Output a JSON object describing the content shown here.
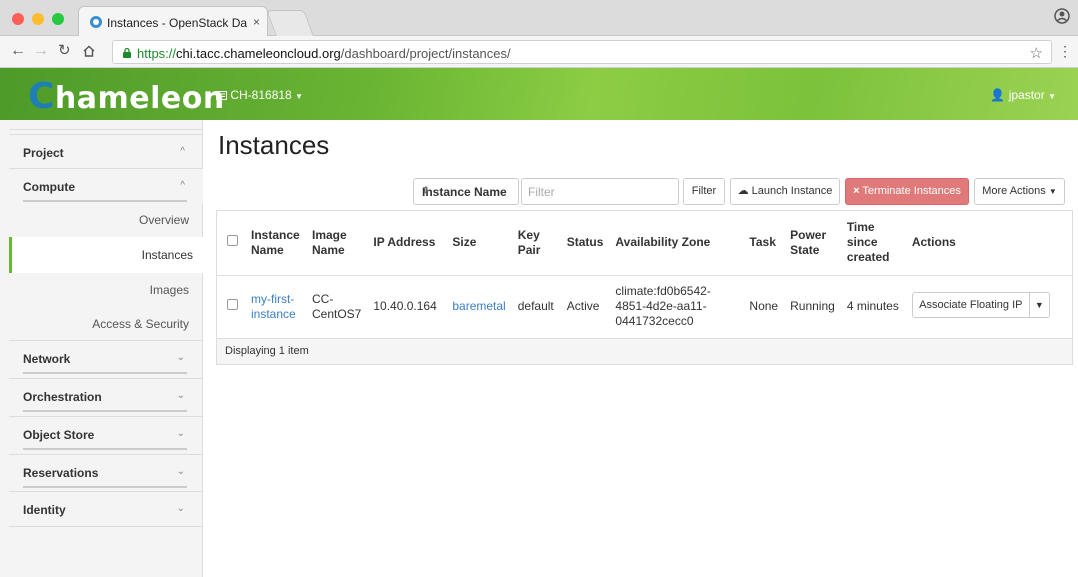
{
  "browser": {
    "tab_title": "Instances - OpenStack Dashbo",
    "tab_close": "×",
    "url_scheme": "https://",
    "url_host": "chi.tacc.chameleoncloud.org",
    "url_path": "/dashboard/project/instances/"
  },
  "header": {
    "logo_first": "C",
    "logo_rest": "hameleon",
    "project": "CH-816818",
    "user": "jpastor"
  },
  "sidebar": {
    "project": "Project",
    "compute": "Compute",
    "overview": "Overview",
    "instances": "Instances",
    "images": "Images",
    "access_security": "Access & Security",
    "network": "Network",
    "orchestration": "Orchestration",
    "object_store": "Object Store",
    "reservations": "Reservations",
    "identity": "Identity"
  },
  "main": {
    "title": "Instances",
    "filter_field": "Instance Name",
    "filter_placeholder": "Filter",
    "filter_button": "Filter",
    "launch_button": "Launch Instance",
    "terminate_button": "Terminate Instances",
    "more_actions": "More Actions"
  },
  "table": {
    "headers": {
      "name": [
        "Instance",
        "Name"
      ],
      "image": [
        "Image",
        "Name"
      ],
      "ip": "IP Address",
      "size": "Size",
      "keypair": [
        "Key",
        "Pair"
      ],
      "status": "Status",
      "zone": "Availability Zone",
      "task": "Task",
      "power": [
        "Power",
        "State"
      ],
      "time": [
        "Time",
        "since",
        "created"
      ],
      "actions": "Actions"
    },
    "row": {
      "name": [
        "my-first-",
        "instance"
      ],
      "image": [
        "CC-",
        "CentOS7"
      ],
      "ip": "10.40.0.164",
      "size": "baremetal",
      "keypair": "default",
      "status": "Active",
      "zone": [
        "climate:fd0b6542-",
        "4851-4d2e-aa11-",
        "0441732cecc0"
      ],
      "task": "None",
      "power": "Running",
      "time": "4 minutes",
      "action": "Associate Floating IP"
    },
    "footer": "Displaying 1 item"
  },
  "colors": {
    "accent_green": "#6ab533",
    "link_blue": "#3a7ec4",
    "danger": "#e07a7a"
  }
}
